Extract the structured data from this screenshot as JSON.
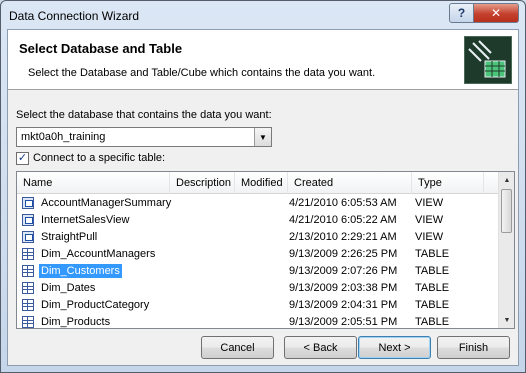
{
  "window": {
    "title": "Data Connection Wizard",
    "help_glyph": "?",
    "close_glyph": "✕"
  },
  "header": {
    "title": "Select Database and Table",
    "subtitle": "Select the Database and Table/Cube which contains the data you want."
  },
  "database": {
    "label": "Select the database that contains the data you want:",
    "selected": "mkt0a0h_training"
  },
  "connect_specific": {
    "label": "Connect to a specific table:",
    "checked": true
  },
  "table_list": {
    "columns": [
      "Name",
      "Description",
      "Modified",
      "Created",
      "Type"
    ],
    "rows": [
      {
        "name": "AccountManagerSummary",
        "description": "",
        "modified": "",
        "created": "4/21/2010 6:05:53 AM",
        "type": "VIEW",
        "icon": "view-icon"
      },
      {
        "name": "InternetSalesView",
        "description": "",
        "modified": "",
        "created": "4/21/2010 6:05:22 AM",
        "type": "VIEW",
        "icon": "view-icon"
      },
      {
        "name": "StraightPull",
        "description": "",
        "modified": "",
        "created": "2/13/2010 2:29:21 AM",
        "type": "VIEW",
        "icon": "view-icon"
      },
      {
        "name": "Dim_AccountManagers",
        "description": "",
        "modified": "",
        "created": "9/13/2009 2:26:25 PM",
        "type": "TABLE",
        "icon": "table-icon"
      },
      {
        "name": "Dim_Customers",
        "description": "",
        "modified": "",
        "created": "9/13/2009 2:07:26 PM",
        "type": "TABLE",
        "icon": "table-icon",
        "selected": true
      },
      {
        "name": "Dim_Dates",
        "description": "",
        "modified": "",
        "created": "9/13/2009 2:03:38 PM",
        "type": "TABLE",
        "icon": "table-icon"
      },
      {
        "name": "Dim_ProductCategory",
        "description": "",
        "modified": "",
        "created": "9/13/2009 2:04:31 PM",
        "type": "TABLE",
        "icon": "table-icon"
      },
      {
        "name": "Dim_Products",
        "description": "",
        "modified": "",
        "created": "9/13/2009 2:05:51 PM",
        "type": "TABLE",
        "icon": "table-icon"
      }
    ]
  },
  "buttons": {
    "cancel": "Cancel",
    "back": "< Back",
    "next": "Next >",
    "finish": "Finish"
  },
  "colors": {
    "selection": "#3399ff",
    "close": "#c4402d"
  }
}
